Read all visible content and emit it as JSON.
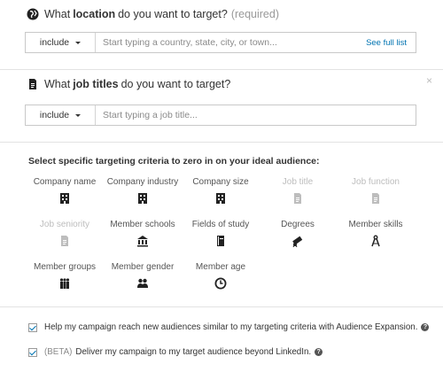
{
  "location": {
    "question_pre": "What",
    "question_bold": "location",
    "question_post": "do you want to target?",
    "required": "(required)",
    "select_value": "include",
    "placeholder": "Start typing a country, state, city, or town...",
    "link": "See full list",
    "icon": "globe-icon"
  },
  "job_titles": {
    "question_pre": "What",
    "question_bold": "job titles",
    "question_post": "do you want to target?",
    "select_value": "include",
    "placeholder": "Start typing a job title...",
    "close": "×",
    "icon": "document-icon"
  },
  "criteria": {
    "title": "Select specific targeting criteria to zero in on your ideal audience:",
    "items": [
      {
        "label": "Company name",
        "icon": "building-icon",
        "enabled": true
      },
      {
        "label": "Company industry",
        "icon": "building-icon",
        "enabled": true
      },
      {
        "label": "Company size",
        "icon": "building-icon",
        "enabled": true
      },
      {
        "label": "Job title",
        "icon": "document-icon",
        "enabled": false
      },
      {
        "label": "Job function",
        "icon": "document-icon",
        "enabled": false
      },
      {
        "label": "Job seniority",
        "icon": "document-icon",
        "enabled": false
      },
      {
        "label": "Member schools",
        "icon": "school-icon",
        "enabled": true
      },
      {
        "label": "Fields of study",
        "icon": "book-icon",
        "enabled": true
      },
      {
        "label": "Degrees",
        "icon": "diploma-icon",
        "enabled": true
      },
      {
        "label": "Member skills",
        "icon": "compass-icon",
        "enabled": true
      },
      {
        "label": "Member groups",
        "icon": "group-icon",
        "enabled": true
      },
      {
        "label": "Member gender",
        "icon": "people-icon",
        "enabled": true
      },
      {
        "label": "Member age",
        "icon": "clock-icon",
        "enabled": true
      }
    ]
  },
  "options": {
    "expansion": {
      "checked": true,
      "label": "Help my campaign reach new audiences similar to my targeting criteria with Audience Expansion.",
      "help": "?"
    },
    "beta": {
      "checked": true,
      "prefix": "(BETA)",
      "label": "Deliver my campaign to my target audience beyond LinkedIn.",
      "help": "?"
    }
  },
  "colors": {
    "link": "#0073b1",
    "disabled": "#bdbdbd",
    "icon": "#222222"
  }
}
